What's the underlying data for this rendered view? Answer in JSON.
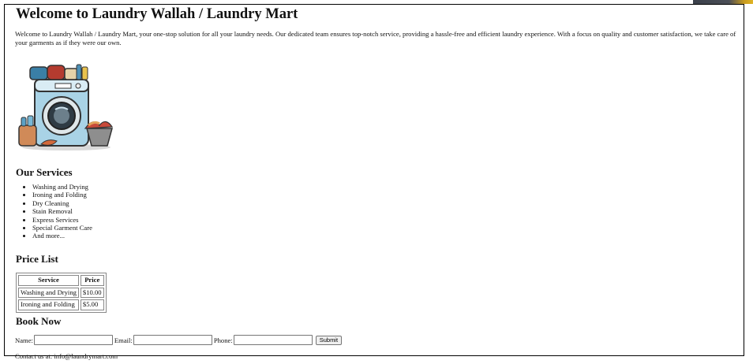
{
  "page": {
    "title": "Welcome to Laundry Wallah / Laundry Mart",
    "intro": "Welcome to Laundry Wallah / Laundry Mart, your one-stop solution for all your laundry needs. Our dedicated team ensures top-notch service, providing a hassle-free and efficient laundry experience. With a focus on quality and customer satisfaction, we take care of your garments as if they were our own."
  },
  "hero": {
    "icon": "washing-machine-laundry-illustration"
  },
  "services": {
    "heading": "Our Services",
    "items": [
      "Washing and Drying",
      "Ironing and Folding",
      "Dry Cleaning",
      "Stain Removal",
      "Express Services",
      "Special Garment Care",
      "And more..."
    ]
  },
  "prices": {
    "heading": "Price List",
    "headers": [
      "Service",
      "Price"
    ],
    "rows": [
      [
        "Washing and Drying",
        "$10.00"
      ],
      [
        "Ironing and Folding",
        "$5.00"
      ]
    ]
  },
  "booking": {
    "heading": "Book Now",
    "name_label": "Name:",
    "name_value": "",
    "email_label": "Email:",
    "email_value": "",
    "phone_label": "Phone:",
    "phone_value": "",
    "submit_label": "Submit"
  },
  "footer": {
    "contact": "Contact us at: info@laundrymart.com"
  }
}
